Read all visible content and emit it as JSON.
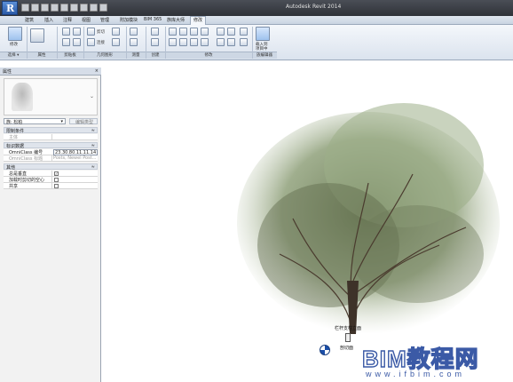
{
  "window": {
    "title": "Autodesk Revit 2014"
  },
  "ribbon": {
    "tabs": [
      "建筑",
      "插入",
      "注释",
      "视图",
      "管理",
      "附加模块",
      "BIM 365",
      "族库大师",
      "修改"
    ],
    "active_tab": "修改",
    "buttons": {
      "modify": "修改",
      "cut": "剪切",
      "join": "连接",
      "load_family": "载入到",
      "load_family2": "项目中"
    },
    "panels": [
      "选择 ▾",
      "属性",
      "剪贴板",
      "几何图形",
      "测量",
      "创建",
      "修改",
      "族编辑器"
    ]
  },
  "properties": {
    "title": "属性",
    "type_name": "族: 松柏",
    "edit_type": "编辑类型",
    "groups": {
      "constraints": "限制条件",
      "identity": "标识数据",
      "other": "其他"
    },
    "rows": {
      "host": {
        "label": "主体",
        "value": ""
      },
      "omniclass_number": {
        "label": "OmniClass 编号",
        "value": "23.30.80.11.11.14"
      },
      "omniclass_title": {
        "label": "OmniClass 标题",
        "value": "Posts, Newel Post..."
      },
      "always_vertical": {
        "label": "总是垂直",
        "checked": true
      },
      "cut_with_voids": {
        "label": "加载时剪切的空心",
        "checked": false
      },
      "shared": {
        "label": "共享",
        "checked": false
      }
    }
  },
  "canvas": {
    "annotation": "栏杆支柱立面",
    "annotation2": "剖切面"
  },
  "watermark": {
    "main": "BIM教程网",
    "sub": "www.ifbim.com"
  }
}
